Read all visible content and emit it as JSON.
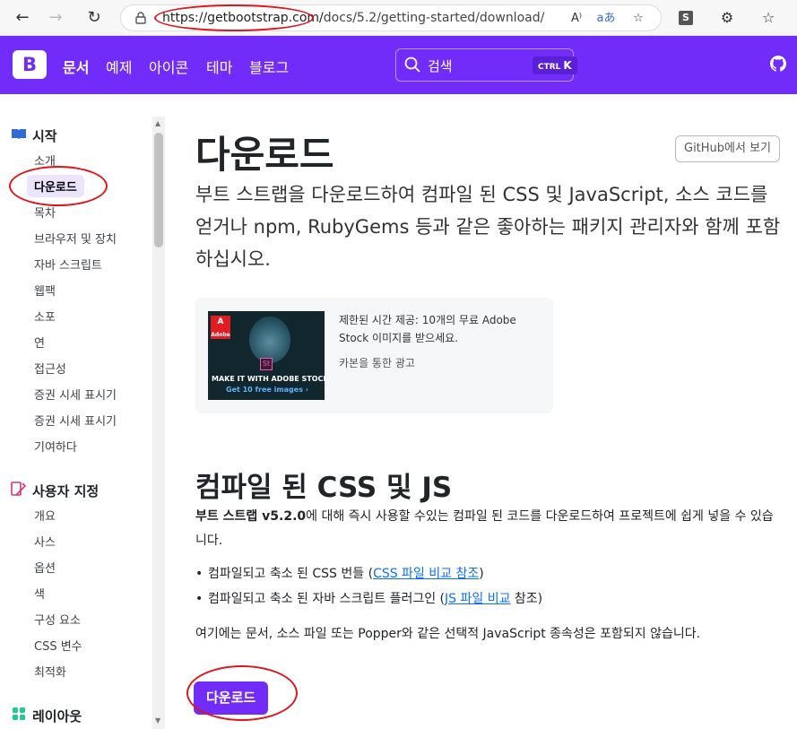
{
  "browser": {
    "url_host": "https://getbootstrap.com/",
    "url_path": "docs/5.2/getting-started/download/",
    "read_aloud_icon": "read-aloud-icon",
    "translate_icon": "translate-icon",
    "ext_s_label": "S"
  },
  "header": {
    "logo_letter": "B",
    "nav": [
      "문서",
      "예제",
      "아이콘",
      "테마",
      "블로그"
    ],
    "search_placeholder": "검색",
    "kbd_ctrl": "CTRL",
    "kbd_key": "K",
    "brand_color": "#712cf9"
  },
  "sidebar": {
    "groups": [
      {
        "title": "시작",
        "items": [
          "소개",
          "다운로드",
          "목차",
          "브라우저 및 장치",
          "자바 스크립트",
          "웹팩",
          "소포",
          "연",
          "접근성",
          "증권 시세 표시기",
          "증권 시세 표시기",
          "기여하다"
        ]
      },
      {
        "title": "사용자 지정",
        "items": [
          "개요",
          "사스",
          "옵션",
          "색",
          "구성 요소",
          "CSS 변수",
          "최적화"
        ]
      },
      {
        "title": "레이아웃",
        "items": []
      }
    ],
    "active_item": "다운로드"
  },
  "main": {
    "github_button": "GitHub에서 보기",
    "title": "다운로드",
    "lead": "부트 스트랩을 다운로드하여 컴파일 된 CSS 및 JavaScript, 소스 코드를 얻거나 npm, RubyGems 등과 같은 좋아하는 패키지 관리자와 함께 포함하십시오.",
    "ad": {
      "text": "제한된 시간 제공: 10개의 무료 Adobe Stock 이미지를 받으세요.",
      "credit": "카본을 통한 광고",
      "logo_text": "Adobe",
      "badge": "St",
      "caption1": "MAKE IT WITH ADOBE STOCK.",
      "caption2": "Get 10 free images ›"
    },
    "section_title": "컴파일 된 CSS 및 JS",
    "intro_bold": "부트 스트랩 v5.2.0",
    "intro_rest": "에 대해 즉시 사용할 수있는 컴파일 된 코드를 다운로드하여 프로젝트에 쉽게 넣을 수 있습니다.",
    "bullets": [
      {
        "before": "컴파일되고 축소 된 CSS 번들 (",
        "link": "CSS 파일 비교 참조",
        "after": ")"
      },
      {
        "before": "컴파일되고 축소 된 자바 스크립트 플러그인 (",
        "link": "JS 파일 비교",
        "after": " 참조)"
      }
    ],
    "note": "여기에는 문서, 소스 파일 또는 Popper와 같은 선택적 JavaScript 종속성은 포함되지 않습니다.",
    "download_button": "다운로드"
  }
}
